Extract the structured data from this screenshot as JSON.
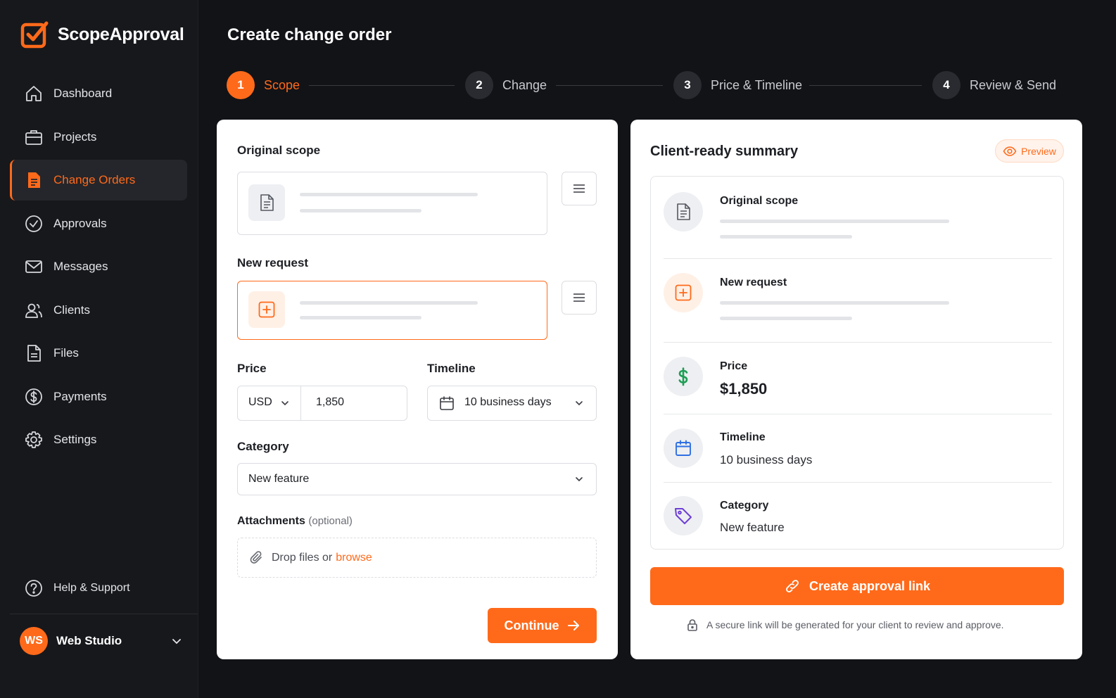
{
  "app": {
    "name": "ScopeApproval"
  },
  "colors": {
    "accent": "#ff6a1a",
    "sidebar_bg": "#17181c",
    "page_bg": "#121317",
    "card_bg": "#ffffff"
  },
  "sidebar": {
    "items": [
      {
        "label": "Dashboard",
        "icon": "home-icon",
        "active": false
      },
      {
        "label": "Projects",
        "icon": "briefcase-icon",
        "active": false
      },
      {
        "label": "Change Orders",
        "icon": "document-icon",
        "active": true
      },
      {
        "label": "Approvals",
        "icon": "check-circle-icon",
        "active": false
      },
      {
        "label": "Messages",
        "icon": "mail-icon",
        "active": false
      },
      {
        "label": "Clients",
        "icon": "users-icon",
        "active": false
      },
      {
        "label": "Files",
        "icon": "file-icon",
        "active": false
      },
      {
        "label": "Payments",
        "icon": "dollar-circle-icon",
        "active": false
      },
      {
        "label": "Settings",
        "icon": "gear-icon",
        "active": false
      }
    ],
    "help_label": "Help & Support",
    "user": {
      "initials": "WS",
      "name": "Web Studio"
    }
  },
  "header": {
    "title": "Create change order"
  },
  "stepper": {
    "steps": [
      {
        "number": "1",
        "label": "Scope",
        "active": true
      },
      {
        "number": "2",
        "label": "Change",
        "active": false
      },
      {
        "number": "3",
        "label": "Price & Timeline",
        "active": false
      },
      {
        "number": "4",
        "label": "Review & Send",
        "active": false
      }
    ]
  },
  "form": {
    "original_scope_label": "Original scope",
    "new_request_label": "New request",
    "price_label": "Price",
    "currency": "USD",
    "price_value": "1,850",
    "timeline_label": "Timeline",
    "timeline_value": "10 business days",
    "category_label": "Category",
    "category_value": "New feature",
    "attachments_label": "Attachments",
    "attachments_optional": "(optional)",
    "dropzone_text": "Drop files or",
    "dropzone_browse": "browse",
    "continue_label": "Continue"
  },
  "summary": {
    "title": "Client-ready summary",
    "preview_label": "Preview",
    "original_scope_label": "Original scope",
    "new_request_label": "New request",
    "price_label": "Price",
    "price_value": "$1,850",
    "timeline_label": "Timeline",
    "timeline_value": "10 business days",
    "category_label": "Category",
    "category_value": "New feature",
    "create_link_label": "Create approval link",
    "secure_note": "A secure link will be generated for your client to review and approve."
  }
}
